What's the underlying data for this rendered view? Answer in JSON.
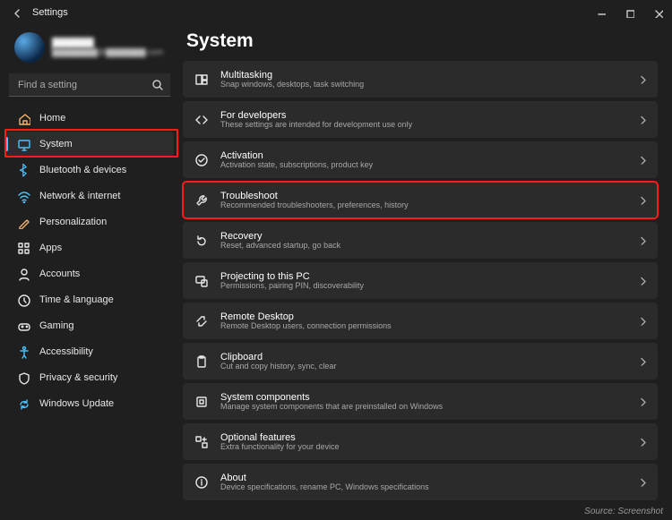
{
  "window": {
    "app_title": "Settings",
    "page_title": "System"
  },
  "user": {
    "name_masked": "██████",
    "email_masked": "████████@███████.com"
  },
  "search": {
    "placeholder": "Find a setting"
  },
  "nav": {
    "items": [
      {
        "id": "home",
        "label": "Home",
        "icon": "home-icon",
        "selected": false
      },
      {
        "id": "system",
        "label": "System",
        "icon": "system-icon",
        "selected": true,
        "highlight": true
      },
      {
        "id": "bluetooth",
        "label": "Bluetooth & devices",
        "icon": "bluetooth-icon",
        "selected": false
      },
      {
        "id": "network",
        "label": "Network & internet",
        "icon": "network-icon",
        "selected": false
      },
      {
        "id": "personal",
        "label": "Personalization",
        "icon": "personalize-icon",
        "selected": false
      },
      {
        "id": "apps",
        "label": "Apps",
        "icon": "apps-icon",
        "selected": false
      },
      {
        "id": "accounts",
        "label": "Accounts",
        "icon": "accounts-icon",
        "selected": false
      },
      {
        "id": "time",
        "label": "Time & language",
        "icon": "time-icon",
        "selected": false
      },
      {
        "id": "gaming",
        "label": "Gaming",
        "icon": "gaming-icon",
        "selected": false
      },
      {
        "id": "access",
        "label": "Accessibility",
        "icon": "accessibility-icon",
        "selected": false
      },
      {
        "id": "privacy",
        "label": "Privacy & security",
        "icon": "privacy-icon",
        "selected": false
      },
      {
        "id": "update",
        "label": "Windows Update",
        "icon": "update-icon",
        "selected": false
      }
    ]
  },
  "cards": [
    {
      "id": "multitasking",
      "title": "Multitasking",
      "subtitle": "Snap windows, desktops, task switching",
      "icon": "multitask-icon"
    },
    {
      "id": "developers",
      "title": "For developers",
      "subtitle": "These settings are intended for development use only",
      "icon": "dev-icon"
    },
    {
      "id": "activation",
      "title": "Activation",
      "subtitle": "Activation state, subscriptions, product key",
      "icon": "activation-icon"
    },
    {
      "id": "troubleshoot",
      "title": "Troubleshoot",
      "subtitle": "Recommended troubleshooters, preferences, history",
      "icon": "troubleshoot-icon",
      "highlight": true
    },
    {
      "id": "recovery",
      "title": "Recovery",
      "subtitle": "Reset, advanced startup, go back",
      "icon": "recovery-icon"
    },
    {
      "id": "projecting",
      "title": "Projecting to this PC",
      "subtitle": "Permissions, pairing PIN, discoverability",
      "icon": "project-icon"
    },
    {
      "id": "remote",
      "title": "Remote Desktop",
      "subtitle": "Remote Desktop users, connection permissions",
      "icon": "remote-icon"
    },
    {
      "id": "clipboard",
      "title": "Clipboard",
      "subtitle": "Cut and copy history, sync, clear",
      "icon": "clipboard-icon"
    },
    {
      "id": "components",
      "title": "System components",
      "subtitle": "Manage system components that are preinstalled on Windows",
      "icon": "components-icon"
    },
    {
      "id": "optional",
      "title": "Optional features",
      "subtitle": "Extra functionality for your device",
      "icon": "optional-icon"
    },
    {
      "id": "about",
      "title": "About",
      "subtitle": "Device specifications, rename PC, Windows specifications",
      "icon": "about-icon"
    }
  ],
  "caption": "Source: Screenshot",
  "nav_icon_colors": {
    "home": "#f6b26b",
    "system": "#4cc2ff",
    "bluetooth": "#4cc2ff",
    "network": "#4cc2ff",
    "personal": "#f6b26b",
    "apps": "#e8e8e8",
    "accounts": "#e8e8e8",
    "time": "#e8e8e8",
    "gaming": "#e8e8e8",
    "access": "#4cc2ff",
    "privacy": "#e8e8e8",
    "update": "#4cc2ff"
  }
}
